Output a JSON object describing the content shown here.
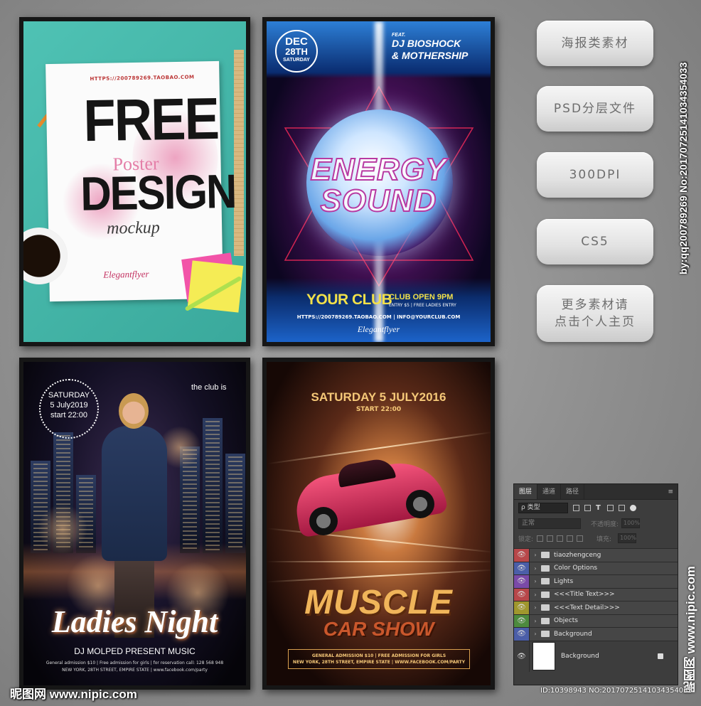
{
  "posters": {
    "free": {
      "url": "HTTPS://200789269.TAOBAO.COM",
      "line1": "FREE",
      "line2": "Poster",
      "line3": "DESIGN",
      "line4": "mockup",
      "signature": "Elegantflyer"
    },
    "energy": {
      "date_month": "DEC",
      "date_day": "28TH",
      "date_weekday": "SATURDAY",
      "feat": "FEAT.",
      "artists": "DJ BIOSHOCK",
      "artists2": "& MOTHERSHIP",
      "title1": "ENERGY",
      "title2": "SOUND",
      "club": "YOUR CLUB",
      "open": "CLUB OPEN 9PM",
      "entry": "ENTRY $5 | FREE LADIES ENTRY",
      "urls": "HTTPS://200789269.TAOBAO.COM | INFO@YOURCLUB.COM",
      "signature": "Elegantflyer"
    },
    "ladies": {
      "circle_line1": "SATURDAY",
      "circle_line2": "5 July2019",
      "circle_line3": "start 22:00",
      "club": "the club is",
      "title": "Ladies Night",
      "dj": "DJ MOLPED PRESENT MUSIC",
      "info1": "General admission $10 | Free admission for girls | for reservation call: 128 568 948",
      "info2": "NEW YORK, 28TH STREET, EMPIRE STATE | www.facebook.com/party"
    },
    "muscle": {
      "date": "SATURDAY 5 JULY2016",
      "start": "START 22:00",
      "title1": "MUSCLE",
      "title2": "CAR SHOW",
      "info1": "GENERAL ADMISSION $10 | FREE ADMISSION FOR GIRLS",
      "info2": "NEW YORK, 28TH STREET, EMPIRE STATE | WWW.FACEBOOK.COM/PARTY"
    }
  },
  "side_buttons": [
    "海报类素材",
    "PSD分层文件",
    "300DPI",
    "CS5",
    "更多素材请\n点击个人主页"
  ],
  "watermarks": {
    "vertical": "by:qq200789269 No:20170725141034354033",
    "nipic_vertical": "昵图网 www.nipic.com",
    "nipic_bottom": "昵图网 www.nipic.com",
    "id": "ID:10398943 NO:20170725141034354033"
  },
  "layers_panel": {
    "tabs": [
      "图层",
      "通道",
      "路径"
    ],
    "filter_label": "ρ 类型",
    "mode": "正常",
    "opacity_label": "不透明度:",
    "opacity_value": "100%",
    "lock_label": "锁定:",
    "fill_label": "填充:",
    "fill_value": "100%",
    "layers": [
      {
        "name": "tiaozhengceng",
        "color": "#b8474a"
      },
      {
        "name": "Color Options",
        "color": "#4b5ea8"
      },
      {
        "name": "Lights",
        "color": "#7a4aa8"
      },
      {
        "name": "<<<Title Text>>>",
        "color": "#b8474a"
      },
      {
        "name": "<<<Text Detail>>>",
        "color": "#a0972d"
      },
      {
        "name": "Objects",
        "color": "#4d8a3e"
      },
      {
        "name": "Background",
        "color": "#4b5ea8"
      }
    ],
    "background_layer": "Background"
  }
}
